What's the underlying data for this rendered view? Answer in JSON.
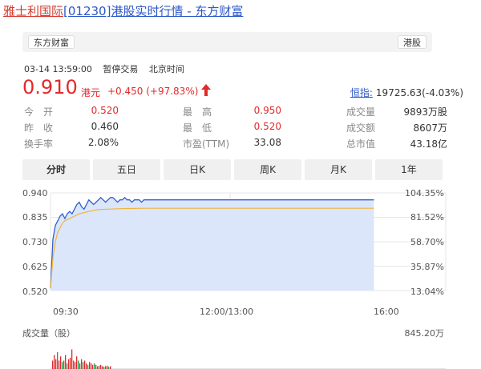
{
  "page_title": {
    "name_link": "雅士利国际",
    "code_link": "[01230]",
    "rest_link": "港股实时行情 - 东方财富"
  },
  "bar": {
    "left_chip": "东方财富",
    "right_chip": "港股"
  },
  "status": {
    "time": "03-14 13:59:00",
    "state": "暂停交易",
    "zone": "北京时间"
  },
  "quote": {
    "price": "0.910",
    "currency": "港元",
    "change": "+0.450 (+97.83%)",
    "index_name": "恒指:",
    "index_value": "19725.63(-4.03%)"
  },
  "stats": {
    "open_label": "今　开",
    "open_value": "0.520",
    "high_label": "最　高",
    "high_value": "0.950",
    "volume_label": "成交量",
    "volume_value": "9893万股",
    "prev_label": "昨　收",
    "prev_value": "0.460",
    "low_label": "最　低",
    "low_value": "0.520",
    "amount_label": "成交额",
    "amount_value": "8607万",
    "turnover_label": "换手率",
    "turnover_value": "2.08%",
    "pe_label": "市盈(TTM)",
    "pe_value": "33.08",
    "mcap_label": "总市值",
    "mcap_value": "43.18亿"
  },
  "tabs": [
    {
      "label": "分时",
      "active": true
    },
    {
      "label": "五日",
      "active": false
    },
    {
      "label": "日K",
      "active": false
    },
    {
      "label": "周K",
      "active": false
    },
    {
      "label": "月K",
      "active": false
    },
    {
      "label": "1年",
      "active": false
    }
  ],
  "colors": {
    "price_line": "#2f5fd0",
    "avg_line": "#f0b43c",
    "fill": "#dbe6fa",
    "up": "#e3292b",
    "down": "#1a9a4c"
  },
  "chart_data": {
    "type": "line",
    "y_left_ticks": [
      "0.940",
      "0.835",
      "0.730",
      "0.625",
      "0.520"
    ],
    "y_right_ticks": [
      "104.35%",
      "81.52%",
      "58.70%",
      "35.87%",
      "13.04%"
    ],
    "x_ticks": [
      "09:30",
      "12:00/13:00",
      "16:00"
    ],
    "ylim": [
      0.52,
      0.94
    ],
    "volume_label": "成交量（股）",
    "volume_max": "845.20万",
    "price": [
      [
        0,
        0.53
      ],
      [
        2,
        0.74
      ],
      [
        4,
        0.8
      ],
      [
        6,
        0.82
      ],
      [
        8,
        0.84
      ],
      [
        10,
        0.85
      ],
      [
        12,
        0.83
      ],
      [
        14,
        0.85
      ],
      [
        16,
        0.86
      ],
      [
        18,
        0.85
      ],
      [
        20,
        0.87
      ],
      [
        22,
        0.89
      ],
      [
        24,
        0.9
      ],
      [
        26,
        0.88
      ],
      [
        28,
        0.87
      ],
      [
        30,
        0.89
      ],
      [
        32,
        0.91
      ],
      [
        34,
        0.9
      ],
      [
        36,
        0.89
      ],
      [
        38,
        0.9
      ],
      [
        40,
        0.91
      ],
      [
        42,
        0.92
      ],
      [
        44,
        0.91
      ],
      [
        46,
        0.9
      ],
      [
        48,
        0.91
      ],
      [
        50,
        0.92
      ],
      [
        52,
        0.92
      ],
      [
        54,
        0.91
      ],
      [
        56,
        0.9
      ],
      [
        58,
        0.91
      ],
      [
        60,
        0.91
      ],
      [
        62,
        0.92
      ],
      [
        64,
        0.91
      ],
      [
        66,
        0.91
      ],
      [
        68,
        0.9
      ],
      [
        70,
        0.91
      ],
      [
        72,
        0.91
      ],
      [
        74,
        0.91
      ],
      [
        76,
        0.9
      ],
      [
        78,
        0.91
      ],
      [
        80,
        0.91
      ],
      [
        90,
        0.91
      ],
      [
        100,
        0.91
      ],
      [
        120,
        0.91
      ],
      [
        140,
        0.91
      ],
      [
        160,
        0.91
      ],
      [
        180,
        0.91
      ],
      [
        200,
        0.91
      ],
      [
        220,
        0.91
      ],
      [
        240,
        0.91
      ],
      [
        260,
        0.91
      ],
      [
        270,
        0.91
      ]
    ],
    "avg": [
      [
        0,
        0.53
      ],
      [
        2,
        0.66
      ],
      [
        4,
        0.73
      ],
      [
        6,
        0.77
      ],
      [
        8,
        0.79
      ],
      [
        10,
        0.81
      ],
      [
        12,
        0.82
      ],
      [
        14,
        0.825
      ],
      [
        16,
        0.83
      ],
      [
        18,
        0.835
      ],
      [
        20,
        0.84
      ],
      [
        24,
        0.85
      ],
      [
        28,
        0.855
      ],
      [
        32,
        0.86
      ],
      [
        36,
        0.865
      ],
      [
        40,
        0.868
      ],
      [
        48,
        0.87
      ],
      [
        56,
        0.872
      ],
      [
        64,
        0.873
      ],
      [
        80,
        0.874
      ],
      [
        120,
        0.874
      ],
      [
        200,
        0.874
      ],
      [
        270,
        0.874
      ]
    ],
    "volume": [
      [
        0,
        0.3,
        "up"
      ],
      [
        1,
        0.5,
        "up"
      ],
      [
        2,
        0.35,
        "up"
      ],
      [
        3,
        0.6,
        "down"
      ],
      [
        4,
        0.3,
        "up"
      ],
      [
        5,
        0.45,
        "up"
      ],
      [
        6,
        0.25,
        "down"
      ],
      [
        7,
        0.3,
        "up"
      ],
      [
        8,
        0.5,
        "up"
      ],
      [
        9,
        0.2,
        "down"
      ],
      [
        10,
        0.35,
        "up"
      ],
      [
        11,
        0.4,
        "up"
      ],
      [
        12,
        0.7,
        "up"
      ],
      [
        13,
        0.3,
        "down"
      ],
      [
        14,
        0.25,
        "up"
      ],
      [
        15,
        0.45,
        "up"
      ],
      [
        16,
        0.3,
        "down"
      ],
      [
        17,
        0.2,
        "up"
      ],
      [
        18,
        0.35,
        "up"
      ],
      [
        19,
        0.25,
        "down"
      ],
      [
        20,
        0.3,
        "up"
      ],
      [
        21,
        0.2,
        "up"
      ],
      [
        22,
        0.15,
        "down"
      ],
      [
        23,
        0.25,
        "up"
      ],
      [
        24,
        0.2,
        "up"
      ],
      [
        25,
        0.15,
        "up"
      ],
      [
        26,
        0.2,
        "down"
      ],
      [
        27,
        0.15,
        "up"
      ],
      [
        28,
        0.1,
        "up"
      ],
      [
        29,
        0.12,
        "down"
      ],
      [
        30,
        0.15,
        "up"
      ],
      [
        31,
        0.1,
        "up"
      ],
      [
        32,
        0.08,
        "down"
      ],
      [
        33,
        0.1,
        "up"
      ],
      [
        34,
        0.12,
        "up"
      ],
      [
        35,
        0.08,
        "down"
      ],
      [
        36,
        0.1,
        "up"
      ]
    ]
  }
}
